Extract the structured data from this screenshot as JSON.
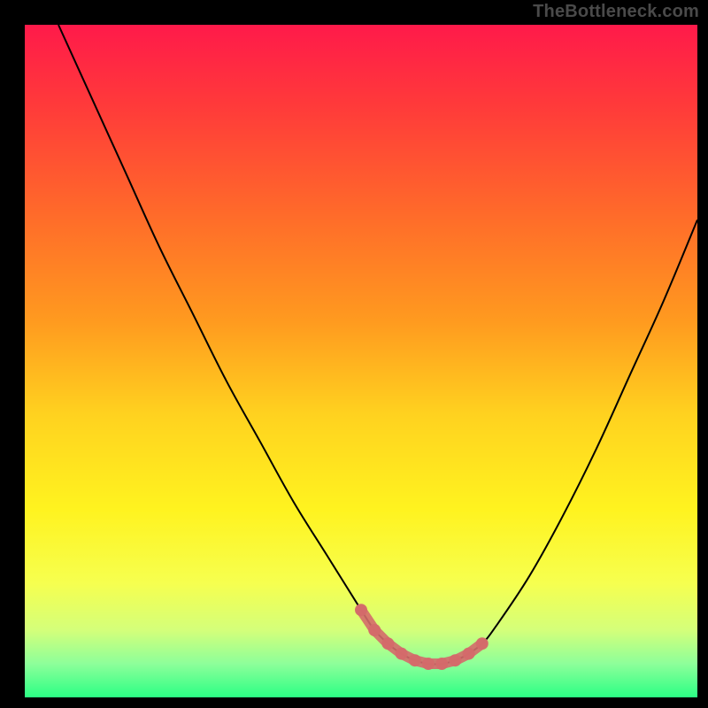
{
  "watermark": "TheBottleneck.com",
  "colors": {
    "black": "#000000",
    "curve_color": "#000000",
    "curve_width": 2,
    "marker_color": "#d46a6a",
    "marker_stroke": "#d46a6a",
    "gradient_stops": [
      {
        "offset": 0.0,
        "color": "#ff1a4a"
      },
      {
        "offset": 0.12,
        "color": "#ff3a3a"
      },
      {
        "offset": 0.28,
        "color": "#ff6a2a"
      },
      {
        "offset": 0.44,
        "color": "#ff9a1f"
      },
      {
        "offset": 0.58,
        "color": "#ffd21f"
      },
      {
        "offset": 0.72,
        "color": "#fff31f"
      },
      {
        "offset": 0.83,
        "color": "#f6ff4f"
      },
      {
        "offset": 0.9,
        "color": "#d4ff7a"
      },
      {
        "offset": 0.95,
        "color": "#8dff9a"
      },
      {
        "offset": 1.0,
        "color": "#2bff84"
      }
    ]
  },
  "chart_data": {
    "type": "line",
    "title": "",
    "xlabel": "",
    "ylabel": "",
    "xlim": [
      0,
      100
    ],
    "ylim": [
      0,
      100
    ],
    "grid": false,
    "legend": false,
    "annotations": [],
    "series": [
      {
        "name": "bottleneck-curve",
        "x": [
          5,
          10,
          15,
          20,
          25,
          30,
          35,
          40,
          45,
          50,
          52,
          54,
          56,
          58,
          60,
          62,
          64,
          66,
          68,
          70,
          75,
          80,
          85,
          90,
          95,
          100
        ],
        "y": [
          100,
          89,
          78,
          67,
          57,
          47,
          38,
          29,
          21,
          13,
          10,
          8,
          6.5,
          5.5,
          5,
          5,
          5.5,
          6.5,
          8,
          10.5,
          18,
          27,
          37,
          48,
          59,
          71
        ]
      }
    ],
    "markers": {
      "name": "highlighted-range",
      "x": [
        50,
        52,
        54,
        56,
        58,
        60,
        62,
        64,
        66,
        68
      ],
      "y": [
        13,
        10,
        8,
        6.5,
        5.5,
        5,
        5,
        5.5,
        6.5,
        8
      ]
    }
  }
}
